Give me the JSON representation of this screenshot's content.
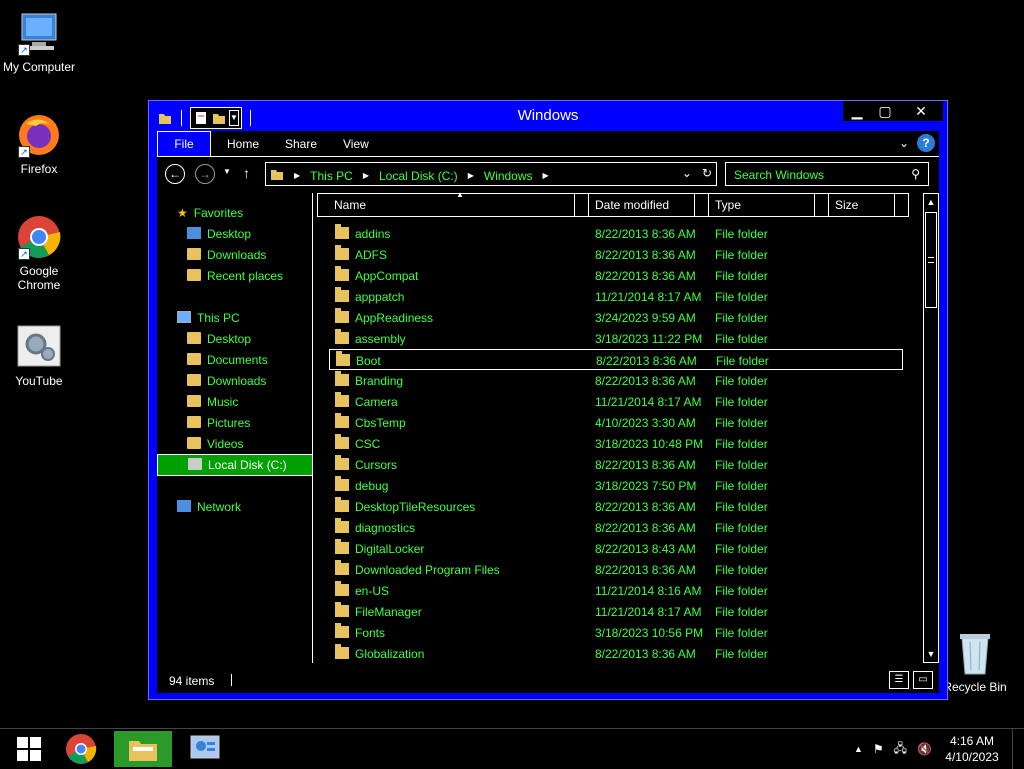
{
  "desktop": {
    "icons": [
      {
        "label": "My Computer"
      },
      {
        "label": "Firefox"
      },
      {
        "label": "Google Chrome"
      },
      {
        "label": "YouTube"
      },
      {
        "label": "Recycle Bin"
      }
    ]
  },
  "window": {
    "title": "Windows",
    "ribbon_tabs": [
      "File",
      "Home",
      "Share",
      "View"
    ],
    "address": {
      "crumbs": [
        "This PC",
        "Local Disk (C:)",
        "Windows"
      ]
    },
    "search_placeholder": "Search Windows",
    "nav": {
      "favorites": "Favorites",
      "favorites_items": [
        "Desktop",
        "Downloads",
        "Recent places"
      ],
      "this_pc": "This PC",
      "this_pc_items": [
        "Desktop",
        "Documents",
        "Downloads",
        "Music",
        "Pictures",
        "Videos",
        "Local Disk (C:)"
      ],
      "network": "Network"
    },
    "columns": [
      "Name",
      "Date modified",
      "Type",
      "Size"
    ],
    "rows": [
      {
        "name": "addins",
        "date": "8/22/2013 8:36 AM",
        "type": "File folder"
      },
      {
        "name": "ADFS",
        "date": "8/22/2013 8:36 AM",
        "type": "File folder"
      },
      {
        "name": "AppCompat",
        "date": "8/22/2013 8:36 AM",
        "type": "File folder"
      },
      {
        "name": "apppatch",
        "date": "11/21/2014 8:17 AM",
        "type": "File folder"
      },
      {
        "name": "AppReadiness",
        "date": "3/24/2023 9:59 AM",
        "type": "File folder"
      },
      {
        "name": "assembly",
        "date": "3/18/2023 11:22 PM",
        "type": "File folder"
      },
      {
        "name": "Boot",
        "date": "8/22/2013 8:36 AM",
        "type": "File folder"
      },
      {
        "name": "Branding",
        "date": "8/22/2013 8:36 AM",
        "type": "File folder"
      },
      {
        "name": "Camera",
        "date": "11/21/2014 8:17 AM",
        "type": "File folder"
      },
      {
        "name": "CbsTemp",
        "date": "4/10/2023 3:30 AM",
        "type": "File folder"
      },
      {
        "name": "CSC",
        "date": "3/18/2023 10:48 PM",
        "type": "File folder"
      },
      {
        "name": "Cursors",
        "date": "8/22/2013 8:36 AM",
        "type": "File folder"
      },
      {
        "name": "debug",
        "date": "3/18/2023 7:50 PM",
        "type": "File folder"
      },
      {
        "name": "DesktopTileResources",
        "date": "8/22/2013 8:36 AM",
        "type": "File folder"
      },
      {
        "name": "diagnostics",
        "date": "8/22/2013 8:36 AM",
        "type": "File folder"
      },
      {
        "name": "DigitalLocker",
        "date": "8/22/2013 8:43 AM",
        "type": "File folder"
      },
      {
        "name": "Downloaded Program Files",
        "date": "8/22/2013 8:36 AM",
        "type": "File folder"
      },
      {
        "name": "en-US",
        "date": "11/21/2014 8:16 AM",
        "type": "File folder"
      },
      {
        "name": "FileManager",
        "date": "11/21/2014 8:17 AM",
        "type": "File folder"
      },
      {
        "name": "Fonts",
        "date": "3/18/2023 10:56 PM",
        "type": "File folder"
      },
      {
        "name": "Globalization",
        "date": "8/22/2013 8:36 AM",
        "type": "File folder"
      }
    ],
    "status": "94 items"
  },
  "taskbar": {
    "time": "4:16 AM",
    "date": "4/10/2023"
  },
  "colors": {
    "window_frame": "#0000ff",
    "text_green": "#3fff3f",
    "selected_nav": "#00a000"
  }
}
